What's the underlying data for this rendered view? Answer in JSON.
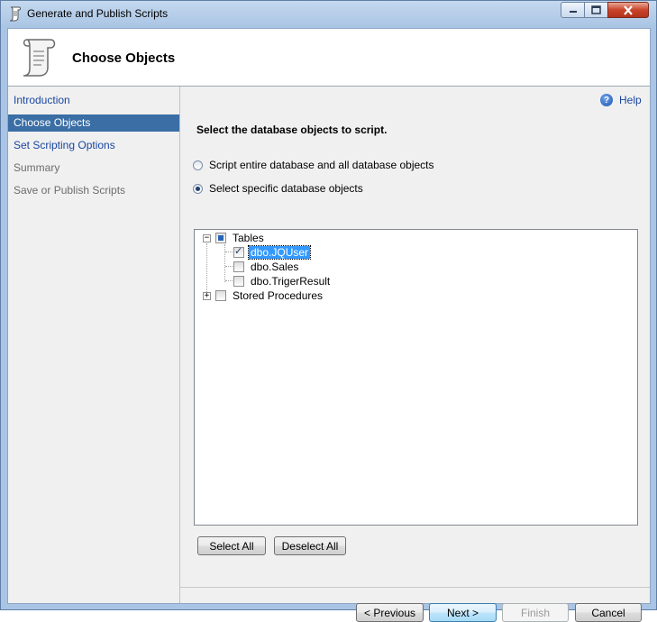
{
  "window": {
    "title": "Generate and Publish Scripts",
    "icon": "scroll-icon"
  },
  "header": {
    "title": "Choose Objects",
    "icon": "scroll-icon"
  },
  "sidebar": {
    "items": [
      {
        "label": "Introduction",
        "state": "link"
      },
      {
        "label": "Choose Objects",
        "state": "selected"
      },
      {
        "label": "Set Scripting Options",
        "state": "link"
      },
      {
        "label": "Summary",
        "state": "disabled"
      },
      {
        "label": "Save or Publish Scripts",
        "state": "disabled"
      }
    ]
  },
  "main": {
    "help_label": "Help",
    "section_title": "Select the database objects to script.",
    "radios": [
      {
        "label": "Script entire database and all database objects",
        "checked": false
      },
      {
        "label": "Select specific database objects",
        "checked": true
      }
    ],
    "tree": {
      "tables_label": "Tables",
      "tables_state": "partial",
      "tables_expanded": true,
      "children": [
        {
          "label": "dbo.JQUser",
          "checked": true,
          "selected": true
        },
        {
          "label": "dbo.Sales",
          "checked": false,
          "selected": false
        },
        {
          "label": "dbo.TrigerResult",
          "checked": false,
          "selected": false
        }
      ],
      "procedures_label": "Stored Procedures",
      "procedures_expanded": false
    },
    "select_all_label": "Select All",
    "deselect_all_label": "Deselect All"
  },
  "footer": {
    "previous_label": "< Previous",
    "next_label": "Next >",
    "finish_label": "Finish",
    "cancel_label": "Cancel"
  },
  "colors": {
    "selection": "#3a6ea5",
    "link": "#1a47a0",
    "frame": "#a9c4e4"
  }
}
